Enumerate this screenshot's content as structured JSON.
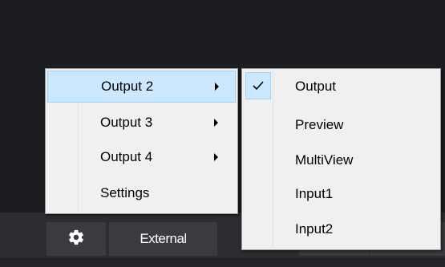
{
  "toolbar": {
    "settings_icon": "gear-icon",
    "external_label": "External"
  },
  "main_menu": {
    "items": [
      {
        "label": "Output 2",
        "has_submenu": true,
        "highlighted": true
      },
      {
        "label": "Output 3",
        "has_submenu": true,
        "highlighted": false
      },
      {
        "label": "Output 4",
        "has_submenu": true,
        "highlighted": false
      },
      {
        "label": "Settings",
        "has_submenu": false,
        "highlighted": false
      }
    ]
  },
  "sub_menu": {
    "items": [
      {
        "label": "Output",
        "checked": true
      },
      {
        "label": "Preview",
        "checked": false
      },
      {
        "label": "MultiView",
        "checked": false
      },
      {
        "label": "Input1",
        "checked": false
      },
      {
        "label": "Input2",
        "checked": false
      }
    ]
  },
  "colors": {
    "app_background": "#1b1c1f",
    "bottom_bar": "#2c2d30",
    "button_face": "#3a3b3e",
    "menu_background": "#f0f0f0",
    "menu_highlight": "#cce8ff",
    "menu_highlight_border": "#99d1ff"
  }
}
